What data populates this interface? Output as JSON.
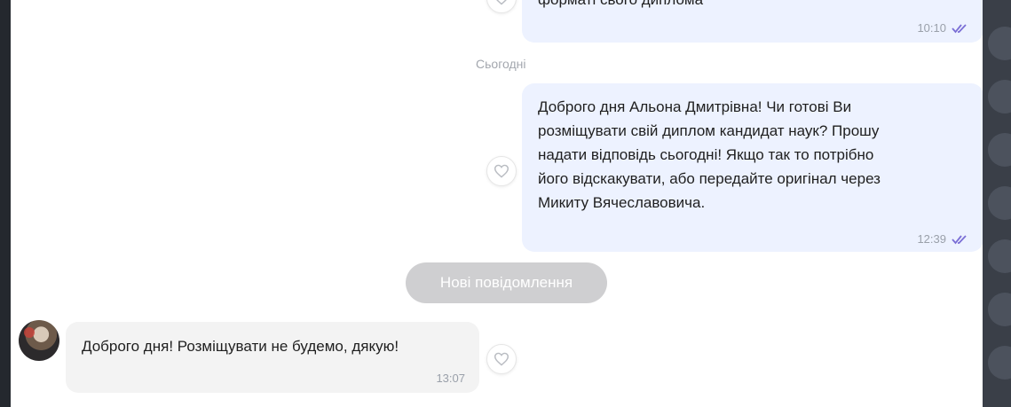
{
  "messages": {
    "prev_out": {
      "text": "форматі свого диплома",
      "time": "10:10"
    },
    "date_separator": "Сьогодні",
    "out_today": {
      "lines": [
        "Доброго дня Альона Дмитрівна! Чи готові Ви",
        "розміщувати свій диплом кандидат наук? Прошу",
        "надати відповідь сьогодні! Якщо так то потрібно",
        "його відскакувати, або передайте оригінал через",
        "Микиту Вячеславовича."
      ],
      "time": "12:39"
    },
    "new_messages_label": "Нові повідомлення",
    "incoming": {
      "text": "Доброго дня! Розміщувати не будемо, дякую!",
      "time": "13:07"
    }
  },
  "icons": {
    "read_receipt": "double-check-icon",
    "reaction": "heart-outline-icon"
  },
  "colors": {
    "outgoing_bubble": "#edf2ff",
    "incoming_bubble": "#f3f3f3",
    "read_check": "#7b6fd6",
    "new_messages_pill": "#cfcfd1"
  }
}
